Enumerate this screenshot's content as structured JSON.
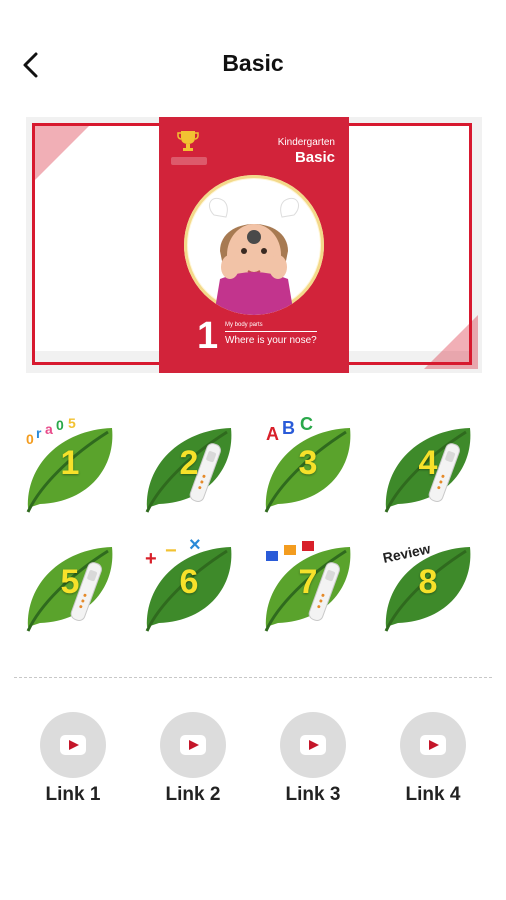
{
  "header": {
    "title": "Basic"
  },
  "banner": {
    "kicker": "Kindergarten",
    "book_title": "Basic",
    "lesson_number": "1",
    "lesson_topic": "My body parts",
    "lesson_question": "Where is your nose?"
  },
  "lessons": [
    {
      "label": "1",
      "decoration": "numbers-text",
      "color": "#5aa32c"
    },
    {
      "label": "2",
      "decoration": "reading-pen",
      "color": "#3e8a2a"
    },
    {
      "label": "3",
      "decoration": "abc-letters",
      "color": "#5aa32c"
    },
    {
      "label": "4",
      "decoration": "reading-pen",
      "color": "#3e8a2a"
    },
    {
      "label": "5",
      "decoration": "reading-pen",
      "color": "#5aa32c"
    },
    {
      "label": "6",
      "decoration": "math-symbols",
      "color": "#3e8a2a"
    },
    {
      "label": "7",
      "decoration": "shapes-and-pen",
      "color": "#5aa32c"
    },
    {
      "label": "8",
      "decoration": "Review",
      "color": "#3e8a2a"
    }
  ],
  "links": [
    {
      "label": "Link 1",
      "icon": "play-icon"
    },
    {
      "label": "Link 2",
      "icon": "play-icon"
    },
    {
      "label": "Link 3",
      "icon": "play-icon"
    },
    {
      "label": "Link 4",
      "icon": "play-icon"
    }
  ],
  "colors": {
    "brand_red": "#d2233a",
    "leaf_light": "#5aa32c",
    "leaf_dark": "#3e8a2a",
    "number_yellow": "#f7e12a"
  }
}
